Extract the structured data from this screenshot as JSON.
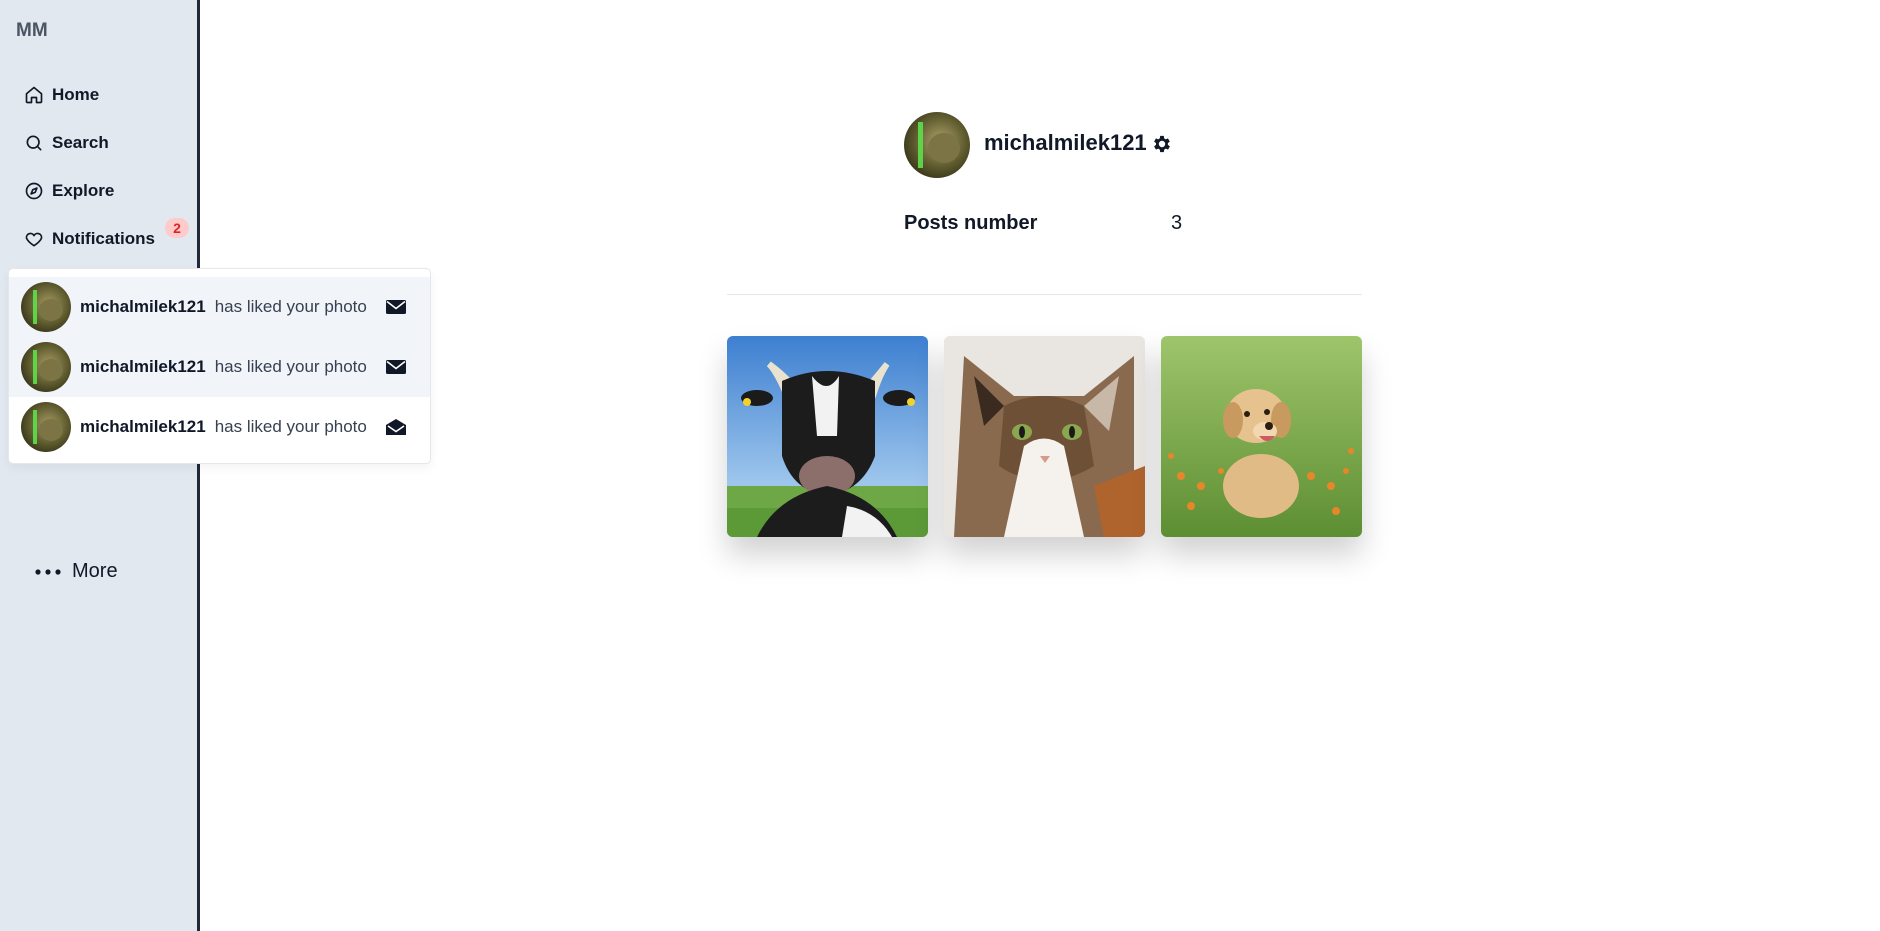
{
  "sidebar": {
    "logo": "MM",
    "nav": {
      "home": "Home",
      "search": "Search",
      "explore": "Explore",
      "notifications": "Notifications"
    },
    "notifications_badge": "2",
    "more": "More"
  },
  "notifications": [
    {
      "user": "michalmilek121",
      "text": "has liked your photo",
      "icon": "envelope-closed-icon",
      "unread": true
    },
    {
      "user": "michalmilek121",
      "text": "has liked your photo",
      "icon": "envelope-closed-icon",
      "unread": true
    },
    {
      "user": "michalmilek121",
      "text": "has liked your photo",
      "icon": "envelope-open-icon",
      "unread": false
    }
  ],
  "profile": {
    "username": "michalmilek121",
    "posts_label": "Posts number",
    "posts_count": "3"
  },
  "posts": [
    {
      "subject": "cow-photo"
    },
    {
      "subject": "cat-photo"
    },
    {
      "subject": "puppy-photo"
    }
  ],
  "colors": {
    "sidebar_bg": "#e2e8f0",
    "badge_bg": "#fecaca",
    "badge_text": "#dc2626",
    "unread_row_bg": "#f1f5f9"
  }
}
